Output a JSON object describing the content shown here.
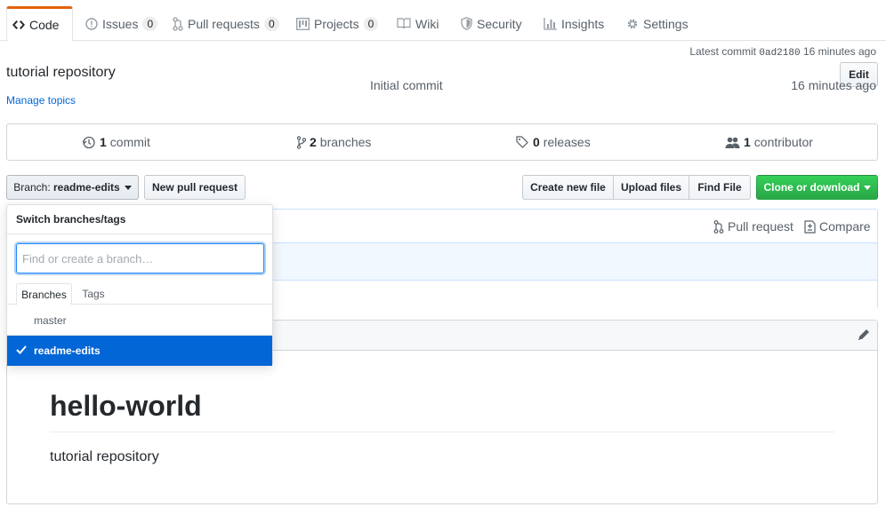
{
  "tabs": [
    {
      "label": "Code",
      "icon": "code-icon",
      "selected": true
    },
    {
      "label": "Issues",
      "count": "0",
      "icon": "issue-icon"
    },
    {
      "label": "Pull requests",
      "count": "0",
      "icon": "git-pull-request-icon"
    },
    {
      "label": "Projects",
      "count": "0",
      "icon": "project-icon"
    },
    {
      "label": "Wiki",
      "icon": "book-icon"
    },
    {
      "label": "Security",
      "icon": "shield-icon"
    },
    {
      "label": "Insights",
      "icon": "graph-icon"
    },
    {
      "label": "Settings",
      "icon": "gear-icon"
    }
  ],
  "repo": {
    "description": "tutorial repository",
    "manage_topics": "Manage topics",
    "edit_label": "Edit"
  },
  "summary": {
    "commits_num": "1",
    "commits_label": "commit",
    "branches_num": "2",
    "branches_label": "branches",
    "releases_num": "0",
    "releases_label": "releases",
    "contributors_num": "1",
    "contributors_label": "contributor"
  },
  "filenav": {
    "branch_prefix": "Branch:",
    "branch_name": "readme-edits",
    "new_pull_request": "New pull request",
    "create_new_file": "Create new file",
    "upload_files": "Upload files",
    "find_file": "Find File",
    "clone_or_download": "Clone or download"
  },
  "commit": {
    "pull_request": "Pull request",
    "compare": "Compare",
    "latest_label": "Latest commit",
    "sha": "0ad2180",
    "latest_age": "16 minutes ago",
    "row_message": "Initial commit",
    "row_age": "16 minutes ago"
  },
  "readme": {
    "heading": "hello-world",
    "body": "tutorial repository"
  },
  "dropdown": {
    "title": "Switch branches/tags",
    "filter_placeholder": "Find or create a branch…",
    "tab_branches": "Branches",
    "tab_tags": "Tags",
    "branches": [
      "master",
      "readme-edits"
    ],
    "selected_branch": "readme-edits"
  },
  "colors": {
    "accent": "#0366d6",
    "selected_tab": "#e36209",
    "primary_button": "#28a745"
  }
}
